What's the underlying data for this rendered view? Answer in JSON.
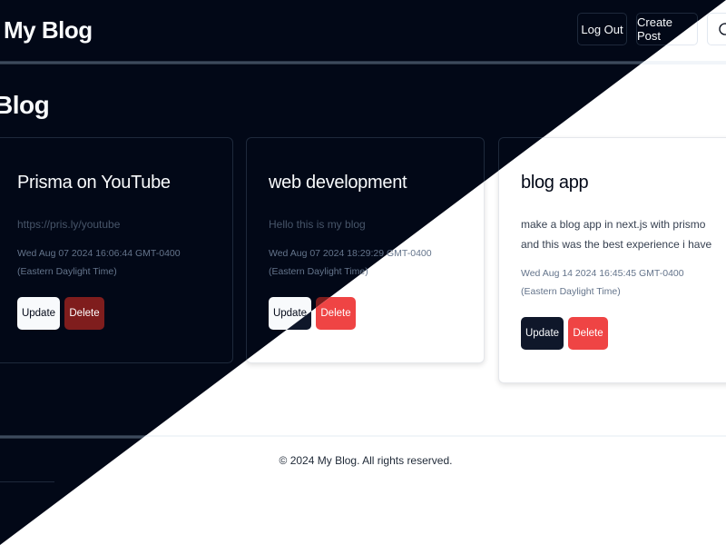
{
  "header": {
    "logo": "My Blog",
    "logout_label": "Log Out",
    "create_label": "Create Post",
    "theme_icon": "theme-toggle-icon"
  },
  "main": {
    "title": "Blog"
  },
  "posts": [
    {
      "title": "Prisma on YouTube",
      "content": "https://pris.ly/youtube",
      "date": "Wed Aug 07 2024 16:06:44 GMT-0400 (Eastern Daylight Time)",
      "update_label": "Update",
      "delete_label": "Delete"
    },
    {
      "title": "web development",
      "content": "Hello this is my blog",
      "date": "Wed Aug 07 2024 18:29:29 GMT-0400 (Eastern Daylight Time)",
      "update_label": "Update",
      "delete_label": "Delete"
    },
    {
      "title": "blog app",
      "content": "make a blog app in next.js with prismo and this was the best experience i have",
      "date": "Wed Aug 14 2024 16:45:45 GMT-0400 (Eastern Daylight Time)",
      "update_label": "Update",
      "delete_label": "Delete"
    }
  ],
  "footer": {
    "text": "© 2024 My Blog. All rights reserved."
  },
  "colors": {
    "dark_background": "#020817",
    "light_background": "#ffffff",
    "dark_delete": "#7f1d1d",
    "light_delete": "#ef4444",
    "light_update": "#0f172a"
  }
}
